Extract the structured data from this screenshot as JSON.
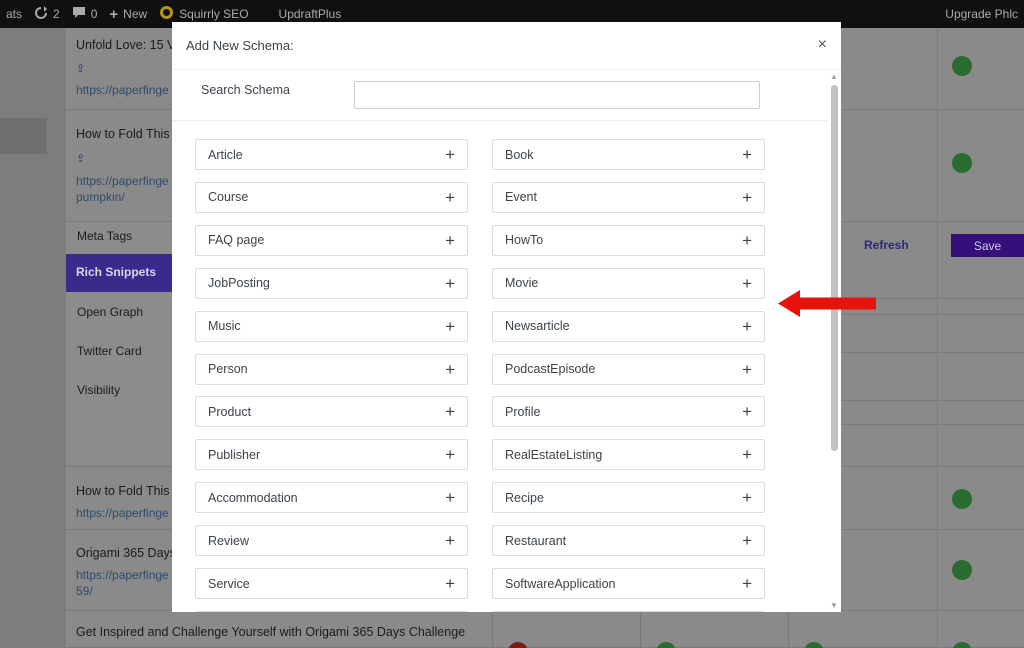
{
  "adminbar": {
    "left_fragment": "ats",
    "updates_count": "2",
    "comments_count": "0",
    "new_label": "New",
    "squirrly_label": "Squirrly SEO",
    "updraft_label": "UpdraftPlus",
    "upgrade_label": "Upgrade Phlc"
  },
  "background": {
    "rows": [
      {
        "title": "Unfold Love: 15 V",
        "url_lines": [
          "https://paperfinge"
        ]
      },
      {
        "title": "How to Fold This",
        "url_lines": [
          "https://paperfinge",
          "pumpkin/"
        ]
      },
      {
        "title": "How to Fold This",
        "url_lines": [
          "https://paperfinge"
        ]
      },
      {
        "title": "Origami 365 Days",
        "url_lines": [
          "https://paperfinge",
          "59/"
        ]
      },
      {
        "title": "Get Inspired and Challenge Yourself with Origami 365 Days Challenge",
        "url_lines": []
      }
    ],
    "side_menu": [
      "Meta Tags",
      "Rich Snippets",
      "Open Graph",
      "Twitter Card",
      "Visibility"
    ],
    "refresh_label": "Refresh",
    "save_label": "Save",
    "colors": {
      "status_green": "#2a6b2f",
      "status_red": "#7a1c16",
      "accent_purple": "#35107a"
    }
  },
  "modal": {
    "title": "Add New Schema:",
    "close_glyph": "×",
    "search_label": "Search Schema",
    "search_value": "",
    "search_placeholder": "",
    "add_glyph": "+",
    "schemas": [
      "Article",
      "Book",
      "Course",
      "Event",
      "FAQ page",
      "HowTo",
      "JobPosting",
      "Movie",
      "Music",
      "Newsarticle",
      "Person",
      "PodcastEpisode",
      "Product",
      "Profile",
      "Publisher",
      "RealEstateListing",
      "Accommodation",
      "Recipe",
      "Review",
      "Restaurant",
      "Service",
      "SoftwareApplication"
    ]
  },
  "annotation": {
    "arrow_color": "#e8120c"
  }
}
